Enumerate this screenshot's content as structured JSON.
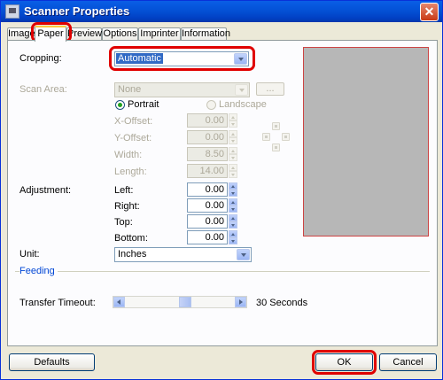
{
  "window": {
    "title": "Scanner Properties",
    "close_symbol": "✕"
  },
  "tabs": [
    {
      "label": "Image"
    },
    {
      "label": "Paper"
    },
    {
      "label": "Preview"
    },
    {
      "label": "Options"
    },
    {
      "label": "Imprinter"
    },
    {
      "label": "Information"
    }
  ],
  "active_tab": "Paper",
  "cropping": {
    "label": "Cropping:",
    "value": "Automatic"
  },
  "scan_area": {
    "label": "Scan Area:",
    "value": "None",
    "browse_label": "..."
  },
  "orientation": {
    "portrait_label": "Portrait",
    "landscape_label": "Landscape",
    "selected": "Portrait"
  },
  "offsets": {
    "x_label": "X-Offset:",
    "x_value": "0.00",
    "y_label": "Y-Offset:",
    "y_value": "0.00",
    "width_label": "Width:",
    "width_value": "8.50",
    "length_label": "Length:",
    "length_value": "14.00"
  },
  "adjustment": {
    "label": "Adjustment:",
    "left_label": "Left:",
    "left_value": "0.00",
    "right_label": "Right:",
    "right_value": "0.00",
    "top_label": "Top:",
    "top_value": "0.00",
    "bottom_label": "Bottom:",
    "bottom_value": "0.00"
  },
  "unit": {
    "label": "Unit:",
    "value": "Inches"
  },
  "feeding": {
    "group_label": "Feeding",
    "timeout_label": "Transfer Timeout:",
    "timeout_value": "30 Seconds",
    "slider_level": 0.55
  },
  "buttons": {
    "defaults": "Defaults",
    "ok": "OK",
    "cancel": "Cancel"
  },
  "colors": {
    "titlebar": "#0453d8",
    "highlight": "#e00000",
    "preview_bg": "#b7b7b7"
  }
}
